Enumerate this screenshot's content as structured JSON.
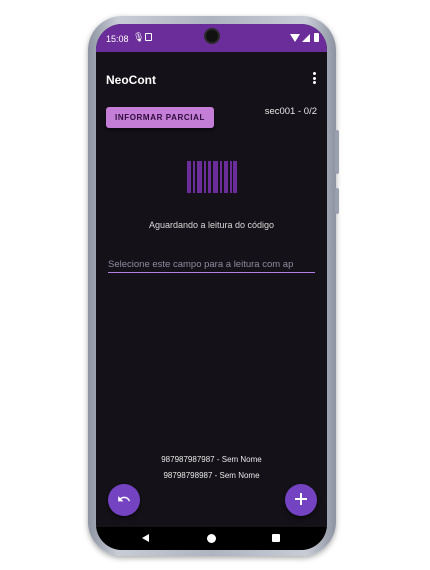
{
  "status_bar": {
    "time": "15:08",
    "icons": [
      "mic-icon",
      "sd-card-icon",
      "camera-icon",
      "wifi-icon",
      "signal-icon",
      "battery-icon"
    ]
  },
  "app_bar": {
    "title": "NeoCont",
    "menu_icon": "more-vert-icon"
  },
  "toolbar": {
    "partial_button_label": "INFORMAR PARCIAL",
    "section_counter": "sec001 - 0/2"
  },
  "scanner": {
    "icon": "barcode-icon",
    "status_text": "Aguardando a leitura do código",
    "input_placeholder": "Selecione este campo para a leitura com ap",
    "input_value": ""
  },
  "read_items": [
    "987987987987 - Sem Nome",
    "98798798987 - Sem Nome"
  ],
  "actions": {
    "undo_icon": "undo-icon",
    "add_icon": "plus-icon"
  },
  "nav_bar": {
    "icons": [
      "back-icon",
      "home-icon",
      "recents-icon"
    ]
  },
  "colors": {
    "status_bar": "#6a2d99",
    "background": "#141218",
    "primary_button": "#c57ed7",
    "accent": "#7443c1",
    "input_underline": "#b37fe0"
  }
}
